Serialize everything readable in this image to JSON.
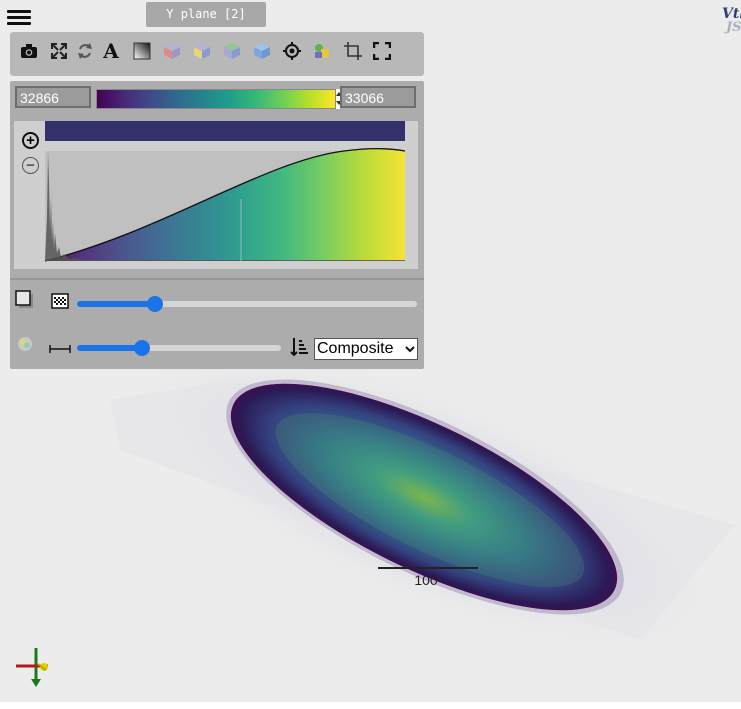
{
  "header": {
    "plane_tab_label": "Y plane [2]",
    "logo_top": "Vtk",
    "logo_bottom": "JS"
  },
  "toolbar": {
    "icons": [
      "camera-icon",
      "fit-view-icon",
      "rotate-icon",
      "text-icon",
      "gradient-icon",
      "cube-x-icon",
      "cube-y-icon",
      "cube-z-icon",
      "cube-iso-icon",
      "target-icon",
      "color-palette-icon",
      "crop-icon",
      "fullscreen-icon"
    ]
  },
  "transfer_function": {
    "range_min": "32866",
    "range_max": "33066",
    "colormap_name": "viridis",
    "colors": [
      "#440154",
      "#482777",
      "#3e4a89",
      "#31688e",
      "#26828e",
      "#1f9e89",
      "#35b779",
      "#6ece58",
      "#b5de2b",
      "#fde725"
    ],
    "header_bar_color": "#33306b"
  },
  "controls": {
    "opacity_level": 0.23,
    "blend_level": 0.32,
    "blend_mode_selected": "Composite"
  },
  "viewport": {
    "scale_bar_label": "100"
  },
  "colors": {
    "accent": "#1a73e8",
    "panel_bg": "#b8b8b8",
    "viewport_bg": "#ececec"
  }
}
